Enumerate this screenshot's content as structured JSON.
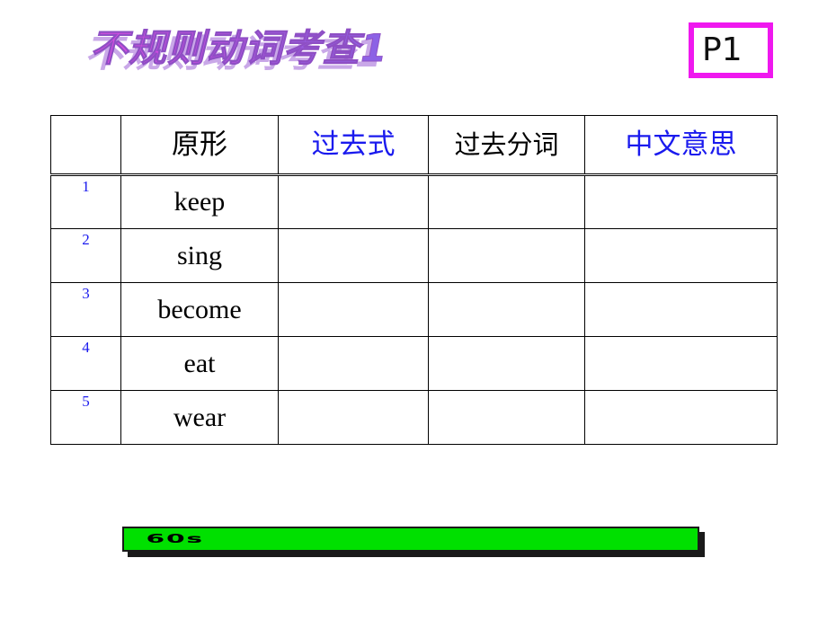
{
  "slide": {
    "title": "不规则动词考查1",
    "page_badge": "P1",
    "accent_magenta": "#ef18ef",
    "accent_blue": "#1a1aee",
    "timer_green": "#00e000"
  },
  "table": {
    "headers": {
      "num": "",
      "base": "原形",
      "past": "过去式",
      "past_participle": "过去分词",
      "chinese": "中文意思"
    },
    "rows": [
      {
        "num": "1",
        "base": "keep",
        "past": "",
        "past_participle": "",
        "chinese": ""
      },
      {
        "num": "2",
        "base": "sing",
        "past": "",
        "past_participle": "",
        "chinese": ""
      },
      {
        "num": "3",
        "base": "become",
        "past": "",
        "past_participle": "",
        "chinese": ""
      },
      {
        "num": "4",
        "base": "eat",
        "past": "",
        "past_participle": "",
        "chinese": ""
      },
      {
        "num": "5",
        "base": "wear",
        "past": "",
        "past_participle": "",
        "chinese": ""
      }
    ]
  },
  "timer": {
    "label": "60s"
  }
}
